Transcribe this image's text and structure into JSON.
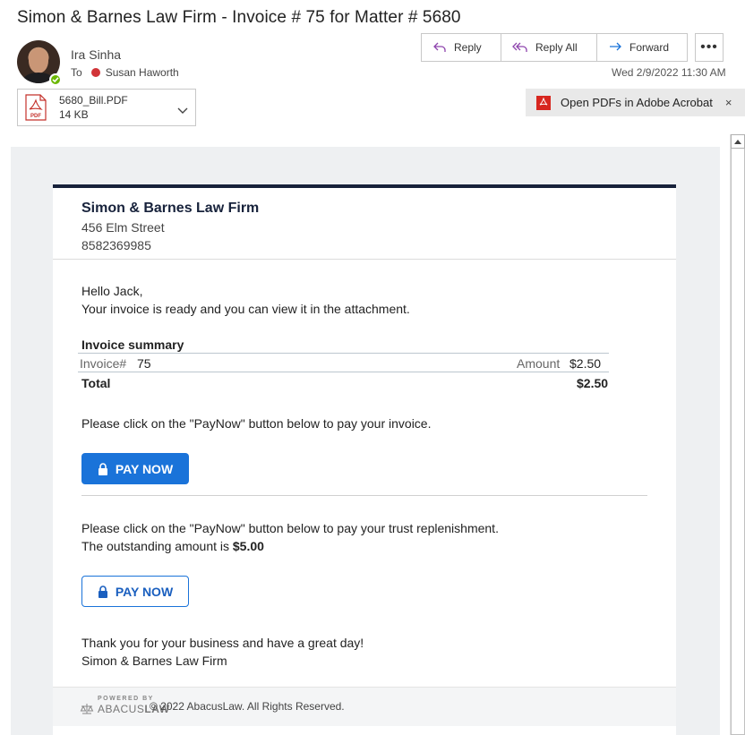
{
  "email": {
    "subject": "Simon & Barnes Law Firm - Invoice # 75 for Matter  # 5680",
    "sender": "Ira Sinha",
    "to_label": "To",
    "recipient": "Susan Haworth",
    "datetime": "Wed 2/9/2022 11:30 AM"
  },
  "actions": {
    "reply": "Reply",
    "reply_all": "Reply All",
    "forward": "Forward",
    "more": "•••"
  },
  "attachment": {
    "name": "5680_Bill.PDF",
    "size": "14 KB",
    "icon_text": "PDF"
  },
  "adobe_bar": {
    "label": "Open PDFs in Adobe Acrobat",
    "close": "×"
  },
  "body": {
    "firm_name": "Simon & Barnes Law Firm",
    "street": "456 Elm Street",
    "phone": "8582369985",
    "greeting": "Hello Jack,",
    "intro": "Your invoice is ready and you can view it in the attachment.",
    "summary_title": "Invoice summary",
    "invoice_label": "Invoice#",
    "invoice_number": "75",
    "amount_label": "Amount",
    "amount_value": "$2.50",
    "total_label": "Total",
    "total_value": "$2.50",
    "pay_prompt": "Please click on the \"PayNow\" button below to pay your invoice.",
    "pay_button": "PAY NOW",
    "trust_prompt": "Please click on the \"PayNow\" button below to pay your trust replenishment.",
    "outstanding_prefix": "The outstanding amount is ",
    "outstanding_amount": "$5.00",
    "trust_button": "PAY NOW",
    "thanks": "Thank you for your business and have a great day!",
    "signature": "Simon & Barnes Law Firm"
  },
  "footer": {
    "powered_by": "POWERED BY",
    "brand_light": "ABACUS",
    "brand_bold": "LAW",
    "copyright": "© 2022 AbacusLaw. All Rights Reserved."
  },
  "colors": {
    "accent_blue": "#1a73d9",
    "header_navy": "#17223b",
    "presence_green": "#6bb700",
    "recipient_red": "#d13438",
    "adobe_red": "#d7261f"
  }
}
